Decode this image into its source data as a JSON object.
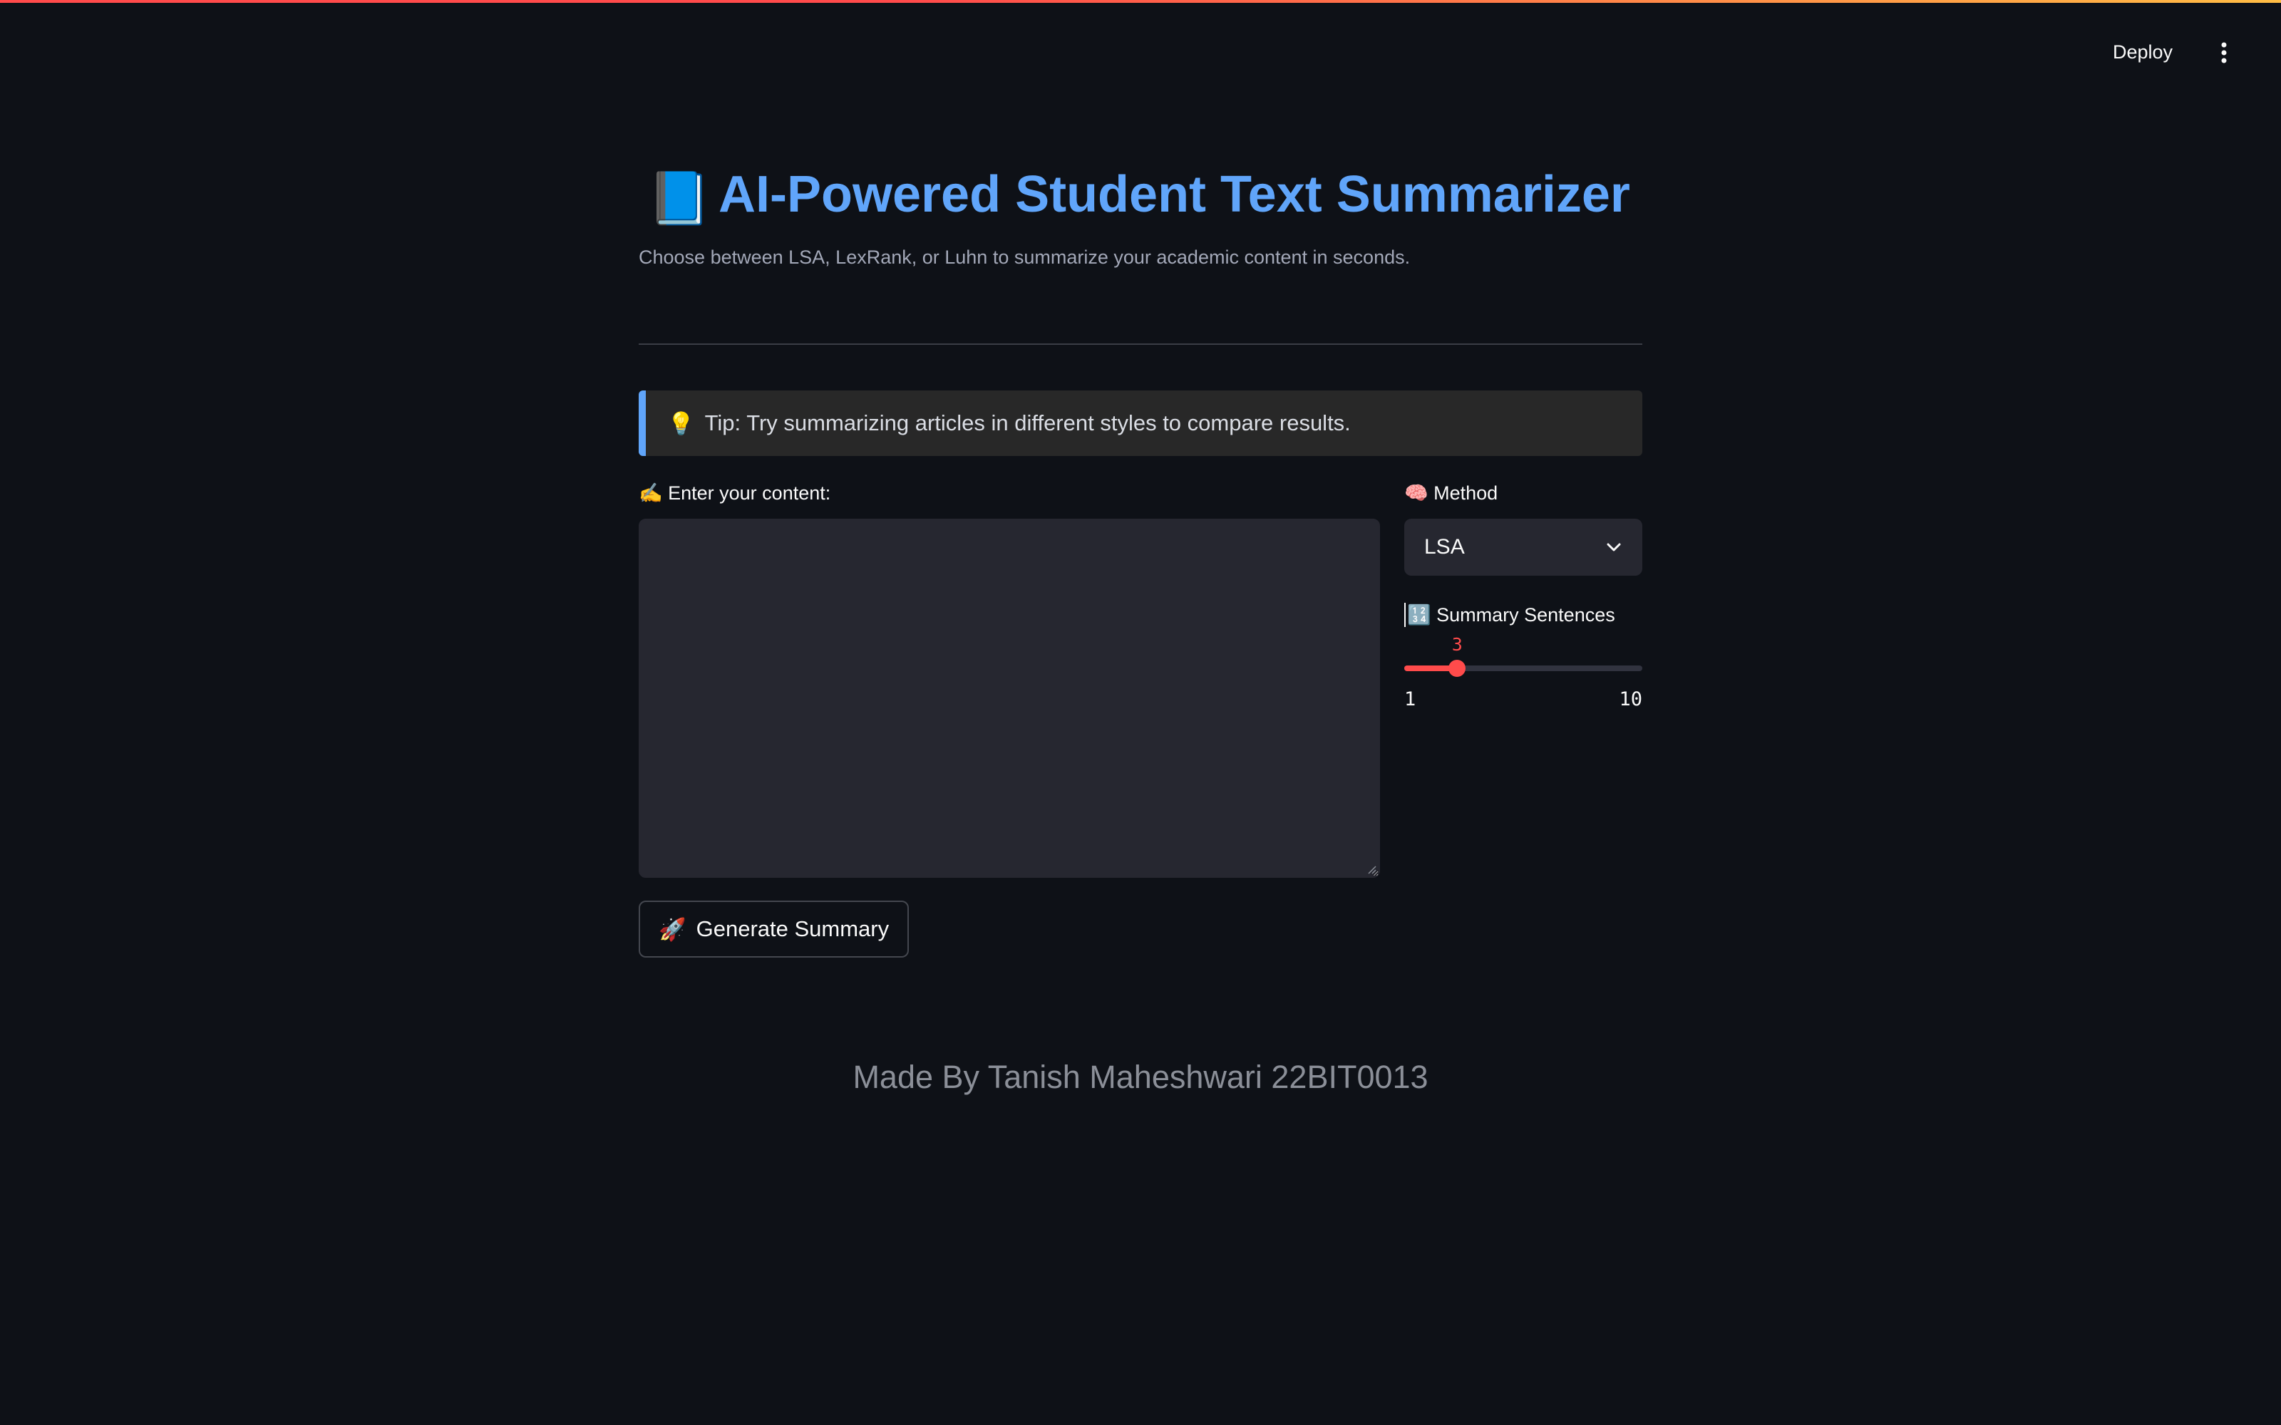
{
  "toolbar": {
    "deploy_label": "Deploy",
    "menu_icon": "vertical-dots-icon"
  },
  "header": {
    "title_emoji": "📘",
    "title": "AI-Powered Student Text Summarizer",
    "subtitle": "Choose between LSA, LexRank, or Luhn to summarize your academic content in seconds."
  },
  "tip": {
    "icon": "💡",
    "text": "Tip: Try summarizing articles in different styles to compare results."
  },
  "content": {
    "label": "✍️ Enter your content:",
    "value": "",
    "placeholder": ""
  },
  "method": {
    "label": "🧠 Method",
    "selected": "LSA"
  },
  "sentences": {
    "label": "🔢 Summary Sentences",
    "value": 3,
    "value_text": "3",
    "min": 1,
    "min_text": "1",
    "max": 10,
    "max_text": "10"
  },
  "generate": {
    "icon": "🚀",
    "label": "Generate Summary"
  },
  "footer": {
    "text": "Made By Tanish Maheshwari 22BIT0013"
  },
  "colors": {
    "accent": "#ff4b4b",
    "title": "#60a5fa",
    "background": "#0e1117",
    "widget": "#262730"
  }
}
